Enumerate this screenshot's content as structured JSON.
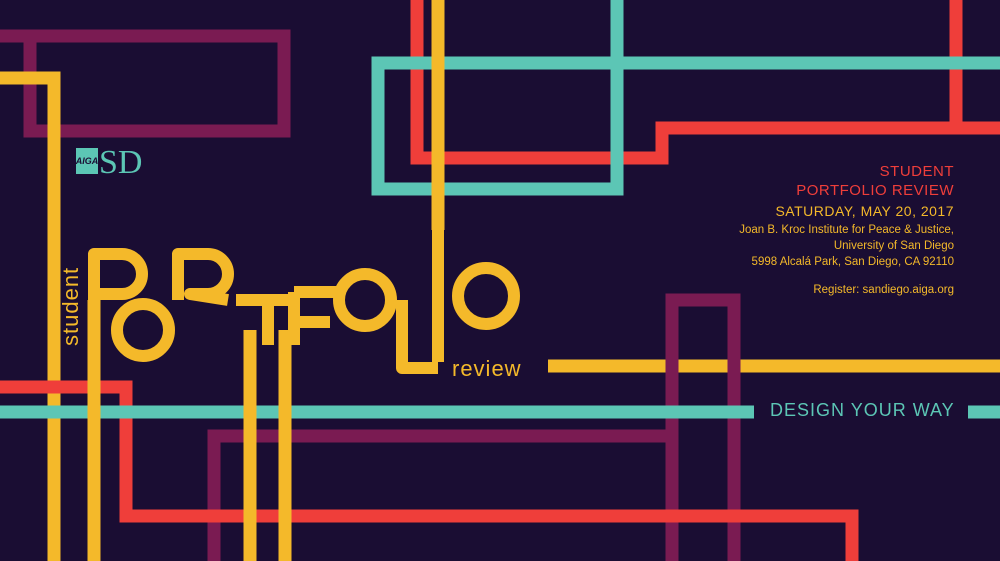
{
  "poster": {
    "logo_small": "AIGA",
    "logo_large": "SD",
    "title_word": "PORTFOLIO",
    "subtitle_left": "student",
    "subtitle_right": "review",
    "event_line1": "STUDENT",
    "event_line2": "PORTFOLIO REVIEW",
    "date": "SATURDAY, MAY 20, 2017",
    "venue_line1": "Joan B. Kroc Institute for Peace & Justice,",
    "venue_line2": "University of San Diego",
    "venue_line3": "5998 Alcalá Park, San Diego, CA 92110",
    "register": "Register: sandiego.aiga.org",
    "tagline": "DESIGN YOUR WAY"
  },
  "colors": {
    "background": "#1a0d33",
    "yellow": "#f4b92a",
    "teal": "#5cc6b5",
    "red": "#ef3e3a",
    "purple": "#7a1b52"
  }
}
